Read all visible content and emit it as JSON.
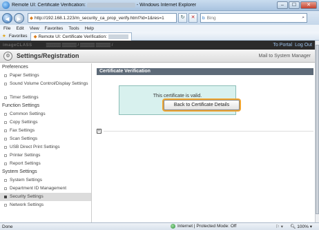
{
  "window": {
    "title_prefix": "Remote UI: Certificate Verification:",
    "title_suffix": "- Windows Internet Explorer",
    "minimize": "–",
    "maximize": "☐",
    "close": "✕"
  },
  "address": {
    "url": "http://192.168.1.223/m_security_ca_prop_verify.html?id=1&res=1",
    "search_placeholder": "Bing",
    "back": "◀",
    "forward": "▶",
    "refresh": "↻",
    "stop": "✕"
  },
  "menu": [
    "File",
    "Edit",
    "View",
    "Favorites",
    "Tools",
    "Help"
  ],
  "favorites": {
    "label": "Favorites",
    "tab_title": "Remote UI: Certificate Verification:"
  },
  "device_bar": {
    "brand": "imageCLASS",
    "portal_link": "To Portal",
    "logout_link": "Log Out"
  },
  "page_header": {
    "title": "Settings/Registration",
    "mail_link": "Mail to System Manager"
  },
  "sidebar": {
    "groups": [
      {
        "label": "Preferences",
        "items": [
          "Paper Settings",
          "Sound Volume Control/Display Settings",
          "Timer Settings"
        ]
      },
      {
        "label": "Function Settings",
        "items": [
          "Common Settings",
          "Copy Settings",
          "Fax Settings",
          "Scan Settings",
          "USB Direct Print Settings",
          "Printer Settings",
          "Report Settings"
        ]
      },
      {
        "label": "System Settings",
        "items": [
          "System Settings",
          "Department ID Management",
          "Security Settings",
          "Network Settings"
        ]
      }
    ]
  },
  "main": {
    "section_title": "Certificate Verification",
    "message": "This certificate is valid.",
    "button_label": "Back to Certificate Details"
  },
  "status": {
    "left": "Done",
    "zone": "Internet | Protected Mode: Off",
    "zoom": "100%"
  }
}
